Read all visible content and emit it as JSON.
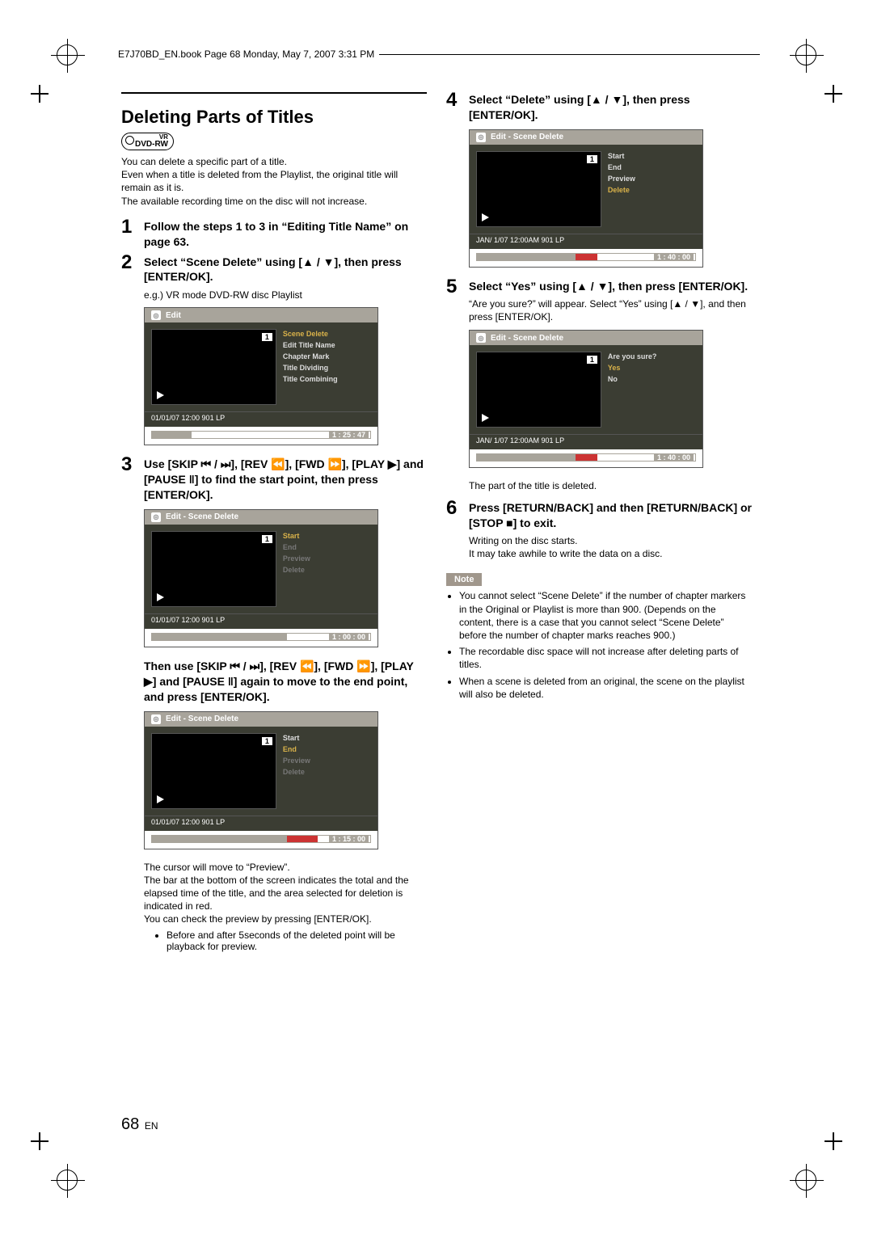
{
  "header": {
    "stamp": "E7J70BD_EN.book  Page 68  Monday, May 7, 2007  3:31 PM"
  },
  "section_title": "Deleting Parts of Titles",
  "dvd_badge": {
    "top": "VR",
    "bottom": "DVD-RW"
  },
  "intro": "You can delete a specific part of a title.\nEven when a title is deleted from the Playlist, the original title will remain as it is.\nThe available recording time on the disc will not increase.",
  "steps": {
    "s1": {
      "num": "1",
      "text": "Follow the steps 1 to 3 in “Editing Title Name” on page 63."
    },
    "s2": {
      "num": "2",
      "text": "Select “Scene Delete” using [▲ / ▼], then press [ENTER/OK].",
      "sub": "e.g.) VR mode DVD-RW disc Playlist"
    },
    "s3": {
      "num": "3",
      "text": "Use [SKIP ⏮ / ⏭], [REV ⏪], [FWD ⏩], [PLAY ▶] and [PAUSE ‖] to find the start point, then press [ENTER/OK]."
    },
    "s3b": {
      "then": "Then use [SKIP ⏮ / ⏭], [REV ⏪], [FWD ⏩], [PLAY ▶] and [PAUSE ‖] again to move to the end point, and press [ENTER/OK]."
    },
    "s3_after": {
      "lines": "The cursor will move to “Preview”.\nThe bar at the bottom of the screen indicates the total and the elapsed time of the title, and the area selected for deletion is indicated in red.\nYou can check the preview by pressing [ENTER/OK].",
      "bullet": "Before and after 5seconds of the deleted point will be playback for preview."
    },
    "s4": {
      "num": "4",
      "text": "Select “Delete” using [▲ / ▼], then press [ENTER/OK]."
    },
    "s5": {
      "num": "5",
      "text": "Select “Yes” using [▲ / ▼], then press [ENTER/OK].",
      "sub": "“Are you sure?” will appear. Select “Yes” using [▲ / ▼], and then press [ENTER/OK]."
    },
    "s5_after": "The part of the title is deleted.",
    "s6": {
      "num": "6",
      "text": "Press [RETURN/BACK] and then [RETURN/BACK] or [STOP ■] to exit.",
      "sub": "Writing on the disc starts.\nIt may take awhile to write the data on a disc."
    }
  },
  "osd": {
    "edit_title": "Edit",
    "scene_delete_title": "Edit - Scene Delete",
    "badge": "1",
    "menu_main": [
      "Scene Delete",
      "Edit Title Name",
      "Chapter Mark",
      "Title Dividing",
      "Title Combining"
    ],
    "menu_phase": [
      "Start",
      "End",
      "Preview",
      "Delete"
    ],
    "menu_confirm": [
      "Are you sure?",
      "Yes",
      "No"
    ],
    "footer_a": "01/01/07 12:00       901  LP",
    "footer_b": "JAN/ 1/07 12:00AM 901   LP",
    "t_main": "1 : 25 : 47",
    "t_start": "1 : 00 : 00",
    "t_end": "1 : 15 : 00",
    "t_step4": "1 : 40 : 00",
    "t_step5": "1 : 40 : 00"
  },
  "note_label": "Note",
  "notes": [
    "You cannot select “Scene Delete” if the number of chapter markers in the Original or Playlist is more than 900. (Depends on the content, there is a case that you cannot select “Scene Delete” before the number of chapter marks reaches 900.)",
    "The recordable disc space will not increase after deleting parts of titles.",
    "When a scene is deleted from an original, the scene on the playlist will also be deleted."
  ],
  "page": {
    "num": "68",
    "lang": "EN"
  }
}
